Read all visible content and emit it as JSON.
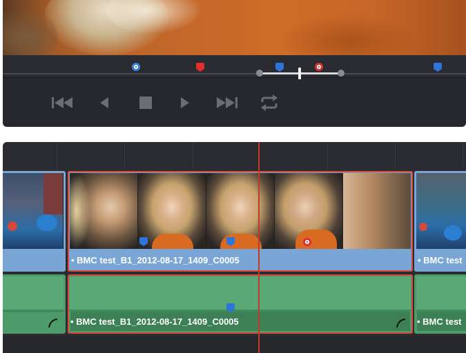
{
  "viewer": {
    "markers": [
      {
        "color": "#3d7fe0",
        "style": "round"
      },
      {
        "color": "#e02f2f",
        "style": "flag"
      },
      {
        "color": "#2f74d8",
        "style": "flag"
      },
      {
        "color": "#e02f2f",
        "style": "round"
      },
      {
        "color": "#2f74d8",
        "style": "flag"
      }
    ],
    "transport": {
      "first_frame": "skip-to-start-icon",
      "reverse": "play-reverse-icon",
      "stop": "stop-icon",
      "play": "play-icon",
      "last_frame": "skip-to-end-icon",
      "loop": "loop-icon"
    }
  },
  "timeline": {
    "video_clips": [
      {
        "label": "",
        "selected": false
      },
      {
        "label": "• BMC test_B1_2012-08-17_1409_C0005",
        "selected": true
      },
      {
        "label": "• BMC test",
        "selected": false
      }
    ],
    "audio_clips": [
      {
        "label": "",
        "selected": false
      },
      {
        "label": "• BMC test_B1_2012-08-17_1409_C0005",
        "selected": true
      },
      {
        "label": "• BMC test",
        "selected": false
      }
    ]
  },
  "colors": {
    "video_clip": "#7aa6d6",
    "audio_clip": "#4d9b6a",
    "selection": "#d84a3a",
    "playhead": "#c2382b"
  }
}
